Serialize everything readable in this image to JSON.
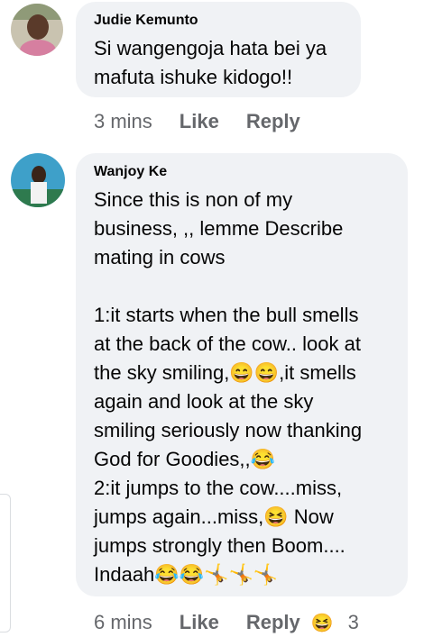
{
  "comments": [
    {
      "author": "Judie Kemunto",
      "lines": [
        "Si wangengoja hata bei ya",
        "mafuta ishuke kidogo!!"
      ],
      "time": "3 mins",
      "like": "Like",
      "reply": "Reply"
    },
    {
      "author": "Wanjoy Ke",
      "para1": [
        "Since this is non of my",
        "business, ,, lemme Describe",
        "mating in cows"
      ],
      "para2": [
        "1:it starts when the bull smells",
        "at the back of the cow.. look at",
        "the sky smiling,😄😄,it smells",
        "again and look at the sky",
        "smiling seriously now thanking",
        "God for Goodies,,😂",
        "2:it jumps to the cow....miss,",
        "jumps again...miss,😆 Now",
        "jumps strongly then Boom....",
        "Indaah😂😂🤸🤸🤸"
      ],
      "time": "6 mins",
      "like": "Like",
      "reply": "Reply",
      "reaction_icon": "😆",
      "reaction_count": "3"
    }
  ],
  "icons": {
    "avatar1": "avatar-icon",
    "avatar2": "avatar-icon"
  },
  "colors": {
    "bubble": "#f0f2f5",
    "meta_text": "#65676b"
  }
}
